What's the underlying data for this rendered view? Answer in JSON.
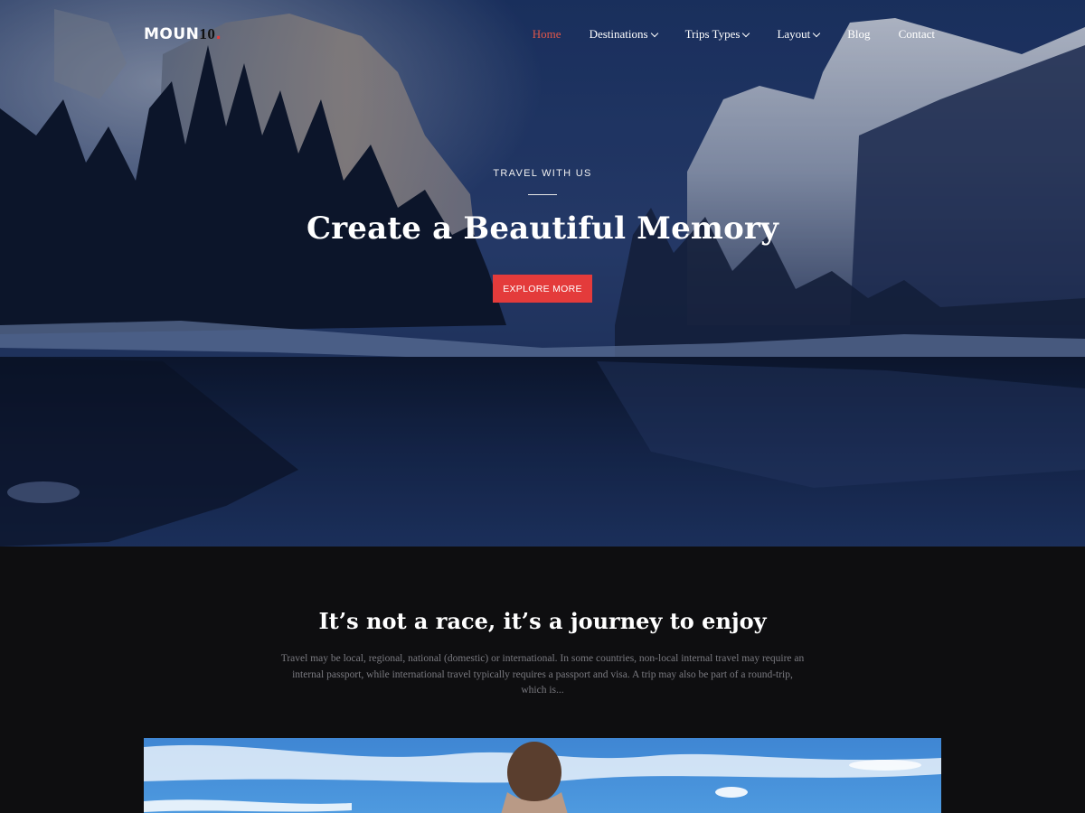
{
  "header": {
    "logo_text": "MOUN",
    "logo_number": "10",
    "logo_dot": ".",
    "nav": [
      {
        "label": "Home",
        "active": true,
        "dropdown": false
      },
      {
        "label": "Destinations",
        "active": false,
        "dropdown": true
      },
      {
        "label": "Trips Types",
        "active": false,
        "dropdown": true
      },
      {
        "label": "Layout",
        "active": false,
        "dropdown": true
      },
      {
        "label": "Blog",
        "active": false,
        "dropdown": false
      },
      {
        "label": "Contact",
        "active": false,
        "dropdown": false
      }
    ]
  },
  "hero": {
    "eyebrow": "TRAVEL WITH US",
    "headline": "Create a Beautiful Memory",
    "cta_label": "EXPLORE MORE"
  },
  "intro": {
    "title": "It’s not a race, it’s a journey to enjoy",
    "text": "Travel may be local, regional, national (domestic) or international. In some countries, non-local internal travel may require an internal passport, while international travel typically requires a passport and visa. A trip may also be part of a round-trip, which is..."
  },
  "colors": {
    "accent": "#e43b3b",
    "nav_active": "#e0574a",
    "page_bg": "#0e0e10"
  }
}
